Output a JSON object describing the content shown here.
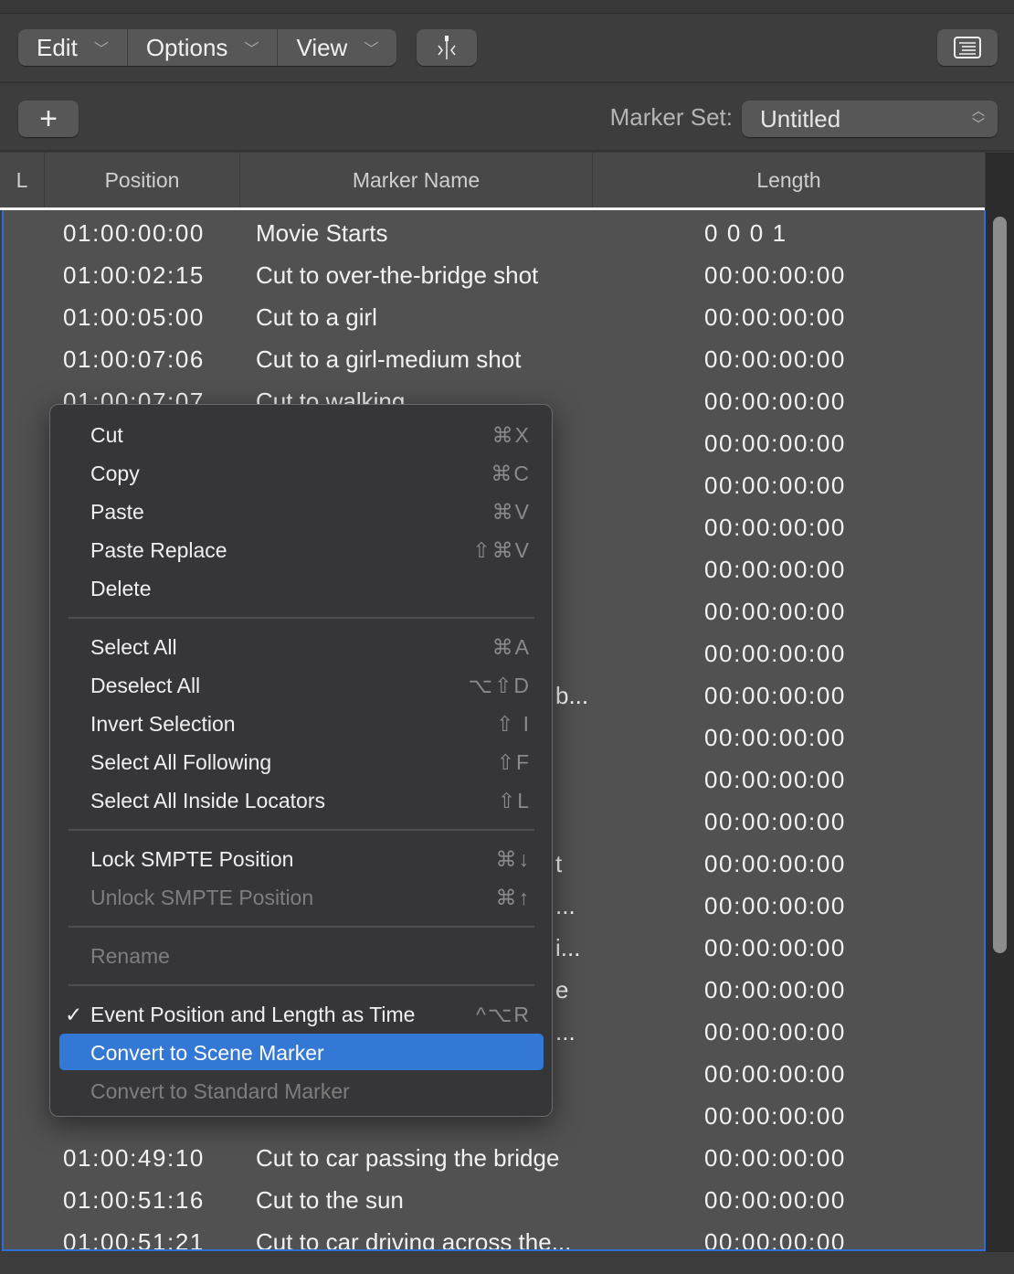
{
  "toolbar": {
    "menus": [
      {
        "label": "Edit"
      },
      {
        "label": "Options"
      },
      {
        "label": "View"
      }
    ],
    "catch_icon": "playhead-catch-icon",
    "list_icon": "list-view-icon"
  },
  "subbar": {
    "add_label": "+",
    "marker_set_label": "Marker Set:",
    "marker_set_value": "Untitled"
  },
  "columns": {
    "lock": "L",
    "position": "Position",
    "name": "Marker Name",
    "length": "Length"
  },
  "rows": [
    {
      "position": "01:00:00:00",
      "name": "Movie Starts",
      "length": "0 0 0    1"
    },
    {
      "position": "01:00:02:15",
      "name": "Cut to over-the-bridge shot",
      "length": "00:00:00:00"
    },
    {
      "position": "01:00:05:00",
      "name": "Cut to a girl",
      "length": "00:00:00:00"
    },
    {
      "position": "01:00:07:06",
      "name": "Cut to a girl-medium shot",
      "length": "00:00:00:00"
    },
    {
      "position": "01:00:07:07",
      "name": "Cut to walking",
      "length": "00:00:00:00"
    },
    {
      "length": "00:00:00:00"
    },
    {
      "length": "00:00:00:00"
    },
    {
      "length": "00:00:00:00"
    },
    {
      "length": "00:00:00:00"
    },
    {
      "length": "00:00:00:00"
    },
    {
      "length": "00:00:00:00"
    },
    {
      "fragment": "b...",
      "length": "00:00:00:00"
    },
    {
      "length": "00:00:00:00"
    },
    {
      "length": "00:00:00:00"
    },
    {
      "length": "00:00:00:00"
    },
    {
      "fragment": "t",
      "length": "00:00:00:00"
    },
    {
      "fragment": "...",
      "length": "00:00:00:00"
    },
    {
      "fragment": "i...",
      "length": "00:00:00:00"
    },
    {
      "fragment": "e",
      "length": "00:00:00:00"
    },
    {
      "fragment": "...",
      "length": "00:00:00:00"
    },
    {
      "length": "00:00:00:00"
    },
    {
      "length": "00:00:00:00"
    },
    {
      "position": "01:00:49:10",
      "name": "Cut to car passing the bridge",
      "length": "00:00:00:00"
    },
    {
      "position": "01:00:51:16",
      "name": "Cut to the sun",
      "length": "00:00:00:00"
    },
    {
      "position": "01:00:51:21",
      "name": "Cut to car driving across the...",
      "length": "00:00:00:00"
    }
  ],
  "context_menu": {
    "items": [
      {
        "label": "Cut",
        "shortcut": "⌘X"
      },
      {
        "label": "Copy",
        "shortcut": "⌘C"
      },
      {
        "label": "Paste",
        "shortcut": "⌘V"
      },
      {
        "label": "Paste Replace",
        "shortcut": "⇧⌘V"
      },
      {
        "label": "Delete",
        "shortcut": ""
      },
      {
        "separator": true
      },
      {
        "label": "Select All",
        "shortcut": "⌘A"
      },
      {
        "label": "Deselect All",
        "shortcut": "⌥⇧D"
      },
      {
        "label": "Invert Selection",
        "shortcut": "⇧ I"
      },
      {
        "label": "Select All Following",
        "shortcut": "⇧F"
      },
      {
        "label": "Select All Inside Locators",
        "shortcut": "⇧L"
      },
      {
        "separator": true
      },
      {
        "label": "Lock SMPTE Position",
        "shortcut": "⌘↓"
      },
      {
        "label": "Unlock SMPTE Position",
        "shortcut": "⌘↑",
        "disabled": true
      },
      {
        "separator": true
      },
      {
        "label": "Rename",
        "shortcut": "",
        "disabled": true
      },
      {
        "separator": true
      },
      {
        "label": "Event Position and Length as Time",
        "shortcut": "^⌥R",
        "checked": true
      },
      {
        "label": "Convert to Scene Marker",
        "shortcut": "",
        "highlighted": true
      },
      {
        "label": "Convert to Standard Marker",
        "shortcut": "",
        "disabled": true
      }
    ]
  },
  "colors": {
    "accent": "#3478d6",
    "selection_border": "#2e6fd6"
  }
}
